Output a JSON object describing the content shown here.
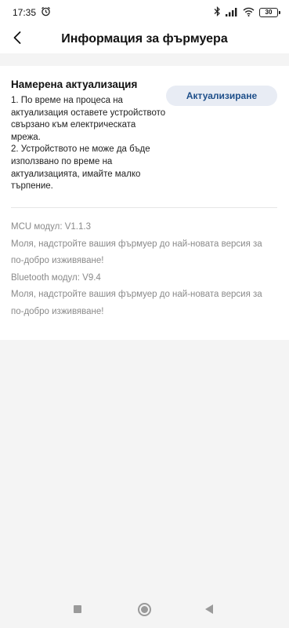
{
  "status_bar": {
    "time": "17:35",
    "battery": "30",
    "icons": [
      "alarm-icon",
      "bluetooth-icon",
      "signal-icon",
      "wifi-icon",
      "battery-icon"
    ]
  },
  "header": {
    "title": "Информация за фърмуера",
    "back_icon": "chevron-left-icon"
  },
  "update": {
    "title": "Намерена актуализация",
    "line1": "1. По време на процеса на актуализация оставете устройството свързано към електрическата мрежа.",
    "line2": "2. Устройството не може да бъде използвано по време на актуализацията, имайте малко търпение.",
    "button_label": "Актуализиране"
  },
  "versions": {
    "mcu_label": "MCU модул: V1.1.3",
    "mcu_message": "Моля, надстройте вашия фърмуер до най-новата версия за по-добро изживяване!",
    "bt_label": "Bluetooth модул: V9.4",
    "bt_message": "Моля, надстройте вашия фърмуер до най-новата версия за по-добро изживяване!"
  },
  "nav_bar": {
    "icons": [
      "recents-square-icon",
      "home-circle-icon",
      "back-triangle-icon"
    ]
  },
  "colors": {
    "accent": "#1e4f8a",
    "button_bg": "#e8ecf4",
    "muted_text": "#8a8a8a",
    "page_bg": "#f4f4f4"
  }
}
